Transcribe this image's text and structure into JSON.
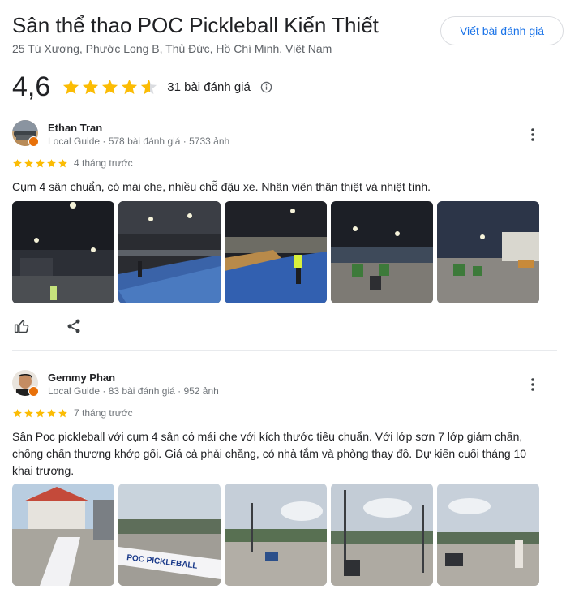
{
  "place": {
    "title": "Sân thể thao POC Pickleball Kiến Thiết",
    "address": "25 Tú Xương, Phước Long B, Thủ Đức, Hồ Chí Minh, Việt Nam"
  },
  "actions": {
    "write_review_label": "Viết bài đánh giá"
  },
  "rating": {
    "value": "4,6",
    "stars": 4.6,
    "count_label": "31 bài đánh giá"
  },
  "reviews": [
    {
      "name": "Ethan Tran",
      "meta": "Local Guide · 578 bài đánh giá · 5733 ảnh",
      "stars": 5,
      "date": "4 tháng trước",
      "text": "Cụm 4 sân chuẩn, có mái che, nhiều chỗ đậu xe. Nhân viên thân thiệt và nhiệt tình.",
      "photo_count": 5
    },
    {
      "name": "Gemmy Phan",
      "meta": "Local Guide · 83 bài đánh giá · 952 ảnh",
      "stars": 5,
      "date": "7 tháng trước",
      "text": "Sân Poc pickleball với cụm 4 sân có mái che với kích thước tiêu chuẩn. Với lớp sơn 7 lớp giảm chấn, chống chấn thương khớp gối. Giá cả phải chăng, có nhà tắm và phòng thay đồ. Dự kiến cuối tháng 10 khai trương.",
      "photo_count": 5,
      "photo_sign_text": "POC PICKLEBALL"
    }
  ],
  "colors": {
    "star": "#fbbc04",
    "link": "#1a73e8",
    "badge": "#e8710a"
  },
  "icons": {
    "like": "thumb-up-icon",
    "share": "share-icon",
    "more": "more-vert-icon",
    "info": "info-icon"
  }
}
